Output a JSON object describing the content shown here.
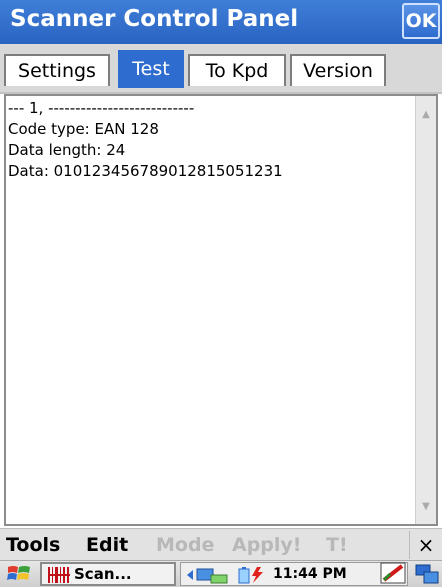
{
  "window": {
    "title": "Scanner Control Panel",
    "ok_label": "OK"
  },
  "tabs": [
    {
      "label": "Settings"
    },
    {
      "label": "Test"
    },
    {
      "label": "To Kpd"
    },
    {
      "label": "Version"
    }
  ],
  "output": {
    "lines": [
      "--- 1, ---------------------------",
      "Code type: EAN 128",
      "Data length: 24",
      "Data: 010123456789012815051231"
    ]
  },
  "menu": {
    "items": [
      {
        "label": "Tools",
        "enabled": true
      },
      {
        "label": "Edit",
        "enabled": true
      },
      {
        "label": "Mode",
        "enabled": false
      },
      {
        "label": "Apply!",
        "enabled": false
      },
      {
        "label": "T!",
        "enabled": false
      }
    ],
    "close_label": "×"
  },
  "taskbar": {
    "task_label": "Scan...",
    "clock": "11:44 PM",
    "icons": [
      "start-icon",
      "barcode-icon",
      "network-icon",
      "battery-icon",
      "stylus-icon",
      "desktop-icon"
    ]
  },
  "colors": {
    "titlebar": "#2a63c2",
    "active_tab": "#2f6cd0"
  }
}
